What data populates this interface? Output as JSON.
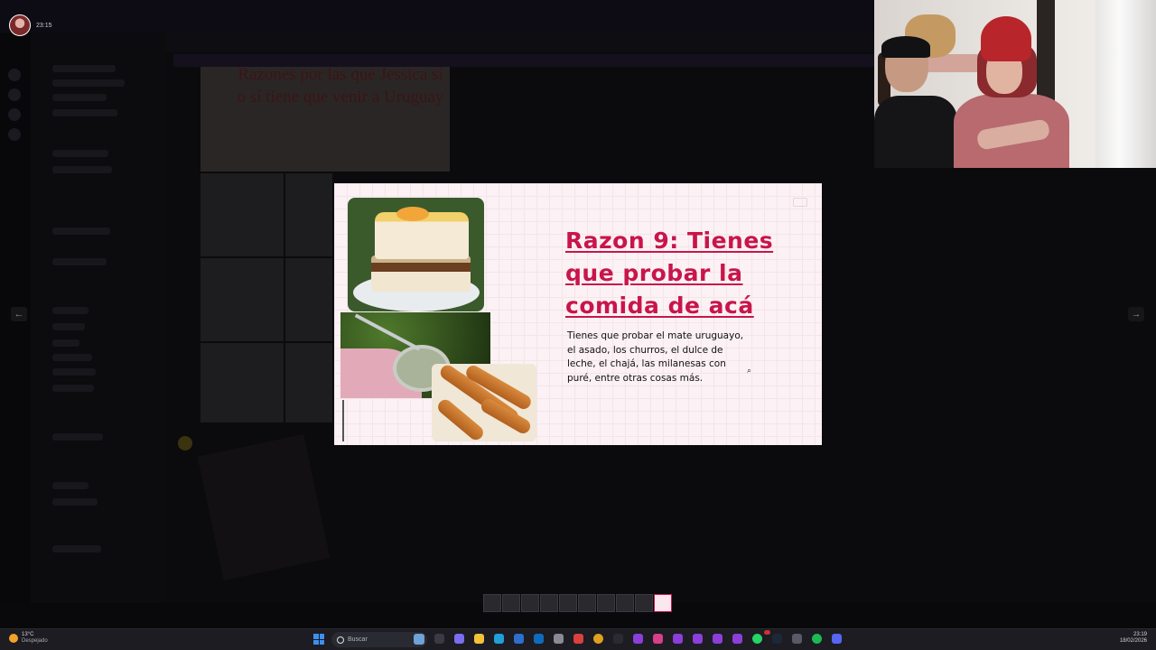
{
  "profile": {
    "name": "",
    "time": "23:15"
  },
  "background_app": {
    "card_title": "Razones por las que Jessica sí o sí tiene que venir a Uruguay"
  },
  "slide": {
    "title": "Razon 9: Tienes que probar la comida de acá",
    "body": "Tienes que probar el mate uruguayo, el asado, los churros, el dulce de leche, el chajá, las milanesas con puré, entre otras cosas más.",
    "accent_color": "#c8154a"
  },
  "nav": {
    "prev": "←",
    "next": "→"
  },
  "taskbar": {
    "weather_temp": "13°C",
    "weather_desc": "Despejado",
    "search_placeholder": "Buscar",
    "clock_time": "23:19",
    "clock_date": "18/02/2026"
  }
}
